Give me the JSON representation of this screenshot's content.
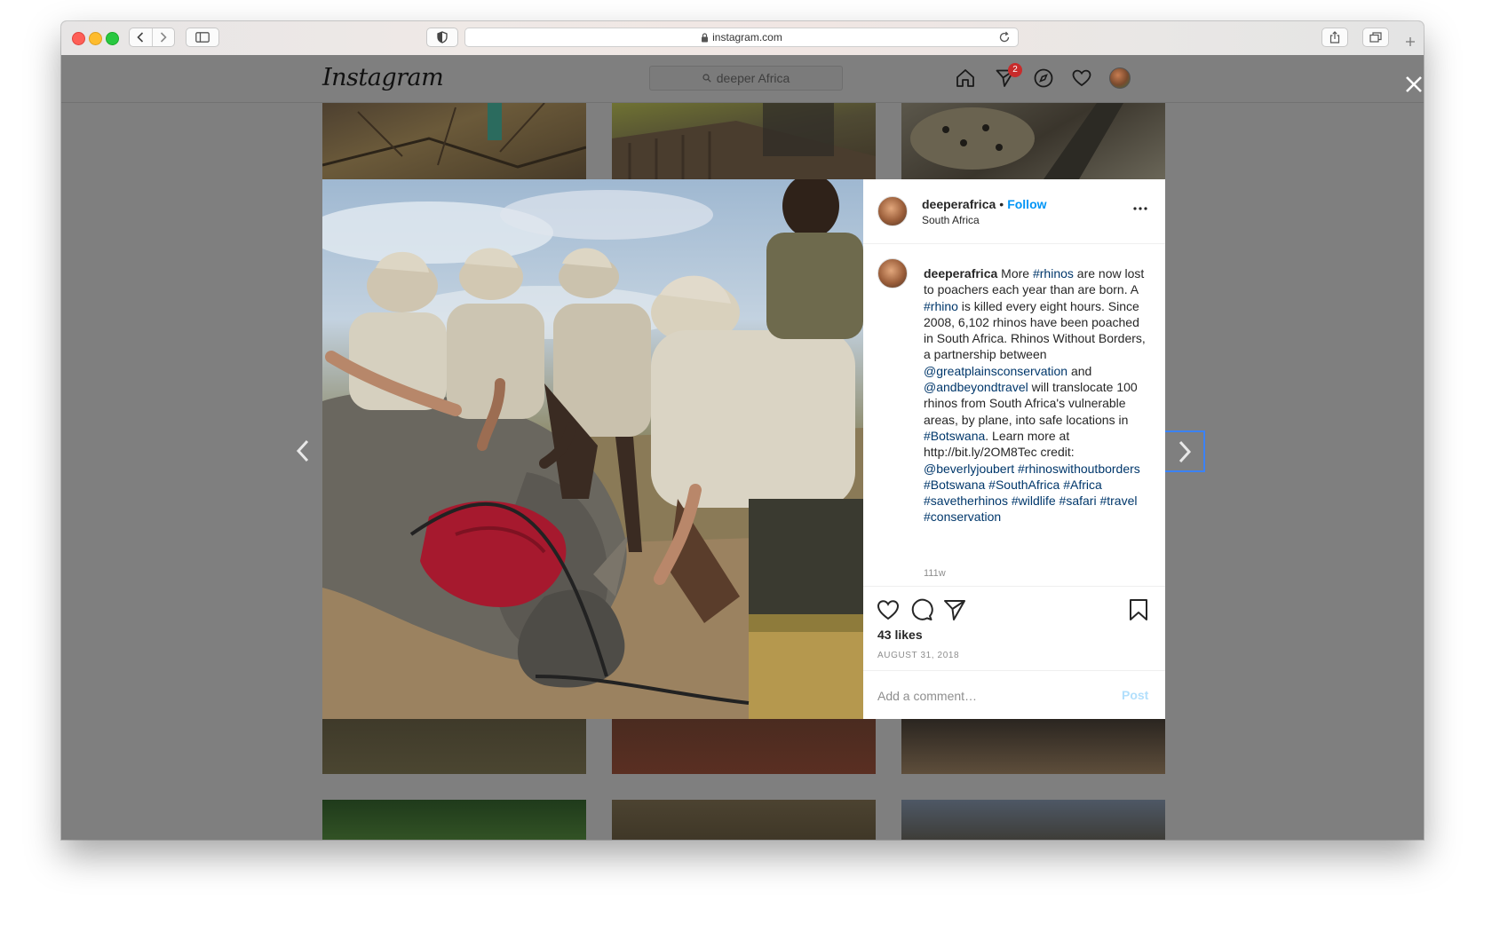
{
  "browser": {
    "url": "instagram.com"
  },
  "header": {
    "logo": "Instagram",
    "search_text": "deeper Africa",
    "notification_count": "2"
  },
  "post": {
    "username": "deeperafrica",
    "follow_label": "Follow",
    "location": "South Africa",
    "caption": [
      {
        "t": "u",
        "v": "deeperafrica"
      },
      {
        "t": "x",
        "v": " More "
      },
      {
        "t": "tag",
        "v": "#rhinos"
      },
      {
        "t": "x",
        "v": " are now lost to poachers each year than are born. A "
      },
      {
        "t": "tag",
        "v": "#rhino"
      },
      {
        "t": "x",
        "v": " is killed every eight hours. Since 2008, 6,102 rhinos have been poached in South Africa. Rhinos Without Borders, a partnership between "
      },
      {
        "t": "tag",
        "v": "@greatplainsconservation"
      },
      {
        "t": "x",
        "v": " and "
      },
      {
        "t": "tag",
        "v": "@andbeyondtravel"
      },
      {
        "t": "x",
        "v": " will translocate 100 rhinos from South Africa's vulnerable areas, by plane, into safe locations in "
      },
      {
        "t": "tag",
        "v": "#Botswana"
      },
      {
        "t": "x",
        "v": ". Learn more at http://bit.ly/2OM8Tec credit: "
      },
      {
        "t": "tag",
        "v": "@beverlyjoubert"
      },
      {
        "t": "x",
        "v": " "
      },
      {
        "t": "tag",
        "v": "#rhinoswithoutborders"
      },
      {
        "t": "x",
        "v": " "
      },
      {
        "t": "tag",
        "v": "#Botswana"
      },
      {
        "t": "x",
        "v": " "
      },
      {
        "t": "tag",
        "v": "#SouthAfrica"
      },
      {
        "t": "x",
        "v": " "
      },
      {
        "t": "tag",
        "v": "#Africa"
      },
      {
        "t": "x",
        "v": " "
      },
      {
        "t": "tag",
        "v": "#savetherhinos"
      },
      {
        "t": "x",
        "v": " "
      },
      {
        "t": "tag",
        "v": "#wildlife"
      },
      {
        "t": "x",
        "v": " "
      },
      {
        "t": "tag",
        "v": "#safari"
      },
      {
        "t": "x",
        "v": " "
      },
      {
        "t": "tag",
        "v": "#travel"
      },
      {
        "t": "x",
        "v": " "
      },
      {
        "t": "tag",
        "v": "#conservation"
      }
    ],
    "age": "111w",
    "likes": "43 likes",
    "date": "AUGUST 31, 2018",
    "comment_placeholder": "Add a comment…",
    "post_label": "Post"
  },
  "colors": {
    "link_blue": "#0095f6",
    "hashtag": "#00376b",
    "overlay": "#7f7f7f"
  },
  "icons": [
    "back-icon",
    "forward-icon",
    "sidebar-icon",
    "shield-icon",
    "lock-icon",
    "reload-icon",
    "share-icon",
    "tabs-icon",
    "plus-icon",
    "search-icon",
    "home-icon",
    "direct-icon",
    "explore-icon",
    "heart-icon",
    "close-icon",
    "more-icon",
    "comment-icon",
    "send-icon",
    "bookmark-icon",
    "chevron-left-icon",
    "chevron-right-icon"
  ]
}
